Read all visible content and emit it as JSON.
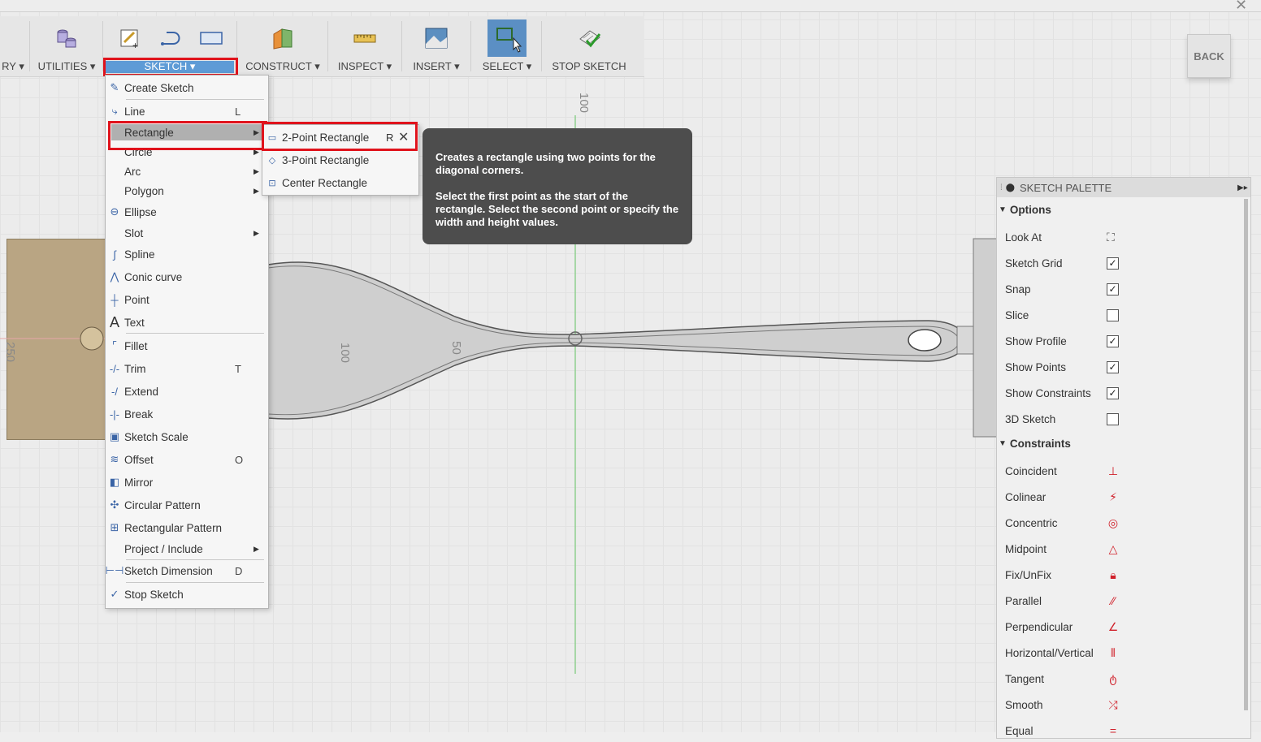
{
  "toolbar": {
    "partial_label": "RY",
    "groups": [
      {
        "label": "UTILITIES"
      },
      {
        "label": "SKETCH"
      },
      {
        "label": "CONSTRUCT"
      },
      {
        "label": "INSPECT"
      },
      {
        "label": "INSERT"
      },
      {
        "label": "SELECT"
      },
      {
        "label": "STOP SKETCH"
      }
    ],
    "dropdown_glyph": "▾"
  },
  "back_button": "BACK",
  "canvas": {
    "axis_labels": [
      "100",
      "100",
      "50",
      "250"
    ]
  },
  "sketch_menu": {
    "items": [
      {
        "label": "Create Sketch",
        "icon": "create-sketch-icon"
      },
      {
        "label": "Line",
        "shortcut": "L",
        "icon": "line-icon"
      },
      {
        "label": "Rectangle",
        "submenu": true
      },
      {
        "label": "Circle",
        "submenu": true
      },
      {
        "label": "Arc",
        "submenu": true
      },
      {
        "label": "Polygon",
        "submenu": true
      },
      {
        "label": "Ellipse",
        "icon": "ellipse-icon"
      },
      {
        "label": "Slot",
        "submenu": true
      },
      {
        "label": "Spline",
        "icon": "spline-icon"
      },
      {
        "label": "Conic curve",
        "icon": "conic-curve-icon"
      },
      {
        "label": "Point",
        "icon": "point-icon"
      },
      {
        "label": "Text",
        "icon": "text-icon"
      },
      {
        "label": "Fillet",
        "icon": "fillet-icon"
      },
      {
        "label": "Trim",
        "shortcut": "T",
        "icon": "trim-icon"
      },
      {
        "label": "Extend",
        "icon": "extend-icon"
      },
      {
        "label": "Break",
        "icon": "break-icon"
      },
      {
        "label": "Sketch Scale",
        "icon": "sketch-scale-icon"
      },
      {
        "label": "Offset",
        "shortcut": "O",
        "icon": "offset-icon"
      },
      {
        "label": "Mirror",
        "icon": "mirror-icon"
      },
      {
        "label": "Circular Pattern",
        "icon": "circular-pattern-icon"
      },
      {
        "label": "Rectangular Pattern",
        "icon": "rectangular-pattern-icon"
      },
      {
        "label": "Project / Include",
        "submenu": true
      },
      {
        "label": "Sketch Dimension",
        "shortcut": "D",
        "icon": "sketch-dimension-icon"
      },
      {
        "label": "Stop Sketch",
        "icon": "stop-sketch-icon"
      }
    ]
  },
  "rectangle_submenu": {
    "items": [
      {
        "label": "2-Point Rectangle",
        "shortcut": "R"
      },
      {
        "label": "3-Point Rectangle"
      },
      {
        "label": "Center Rectangle"
      }
    ]
  },
  "tooltip": {
    "line1": "Creates a rectangle using two points for the diagonal corners.",
    "line2": "Select the first point as the start of the rectangle. Select the second point or specify the width and height values."
  },
  "palette": {
    "title": "SKETCH PALETTE",
    "options_header": "Options",
    "options": [
      {
        "label": "Look At",
        "type": "button"
      },
      {
        "label": "Sketch Grid",
        "checked": true
      },
      {
        "label": "Snap",
        "checked": true
      },
      {
        "label": "Slice",
        "checked": false
      },
      {
        "label": "Show Profile",
        "checked": true
      },
      {
        "label": "Show Points",
        "checked": true
      },
      {
        "label": "Show Constraints",
        "checked": true
      },
      {
        "label": "3D Sketch",
        "checked": false
      }
    ],
    "constraints_header": "Constraints",
    "constraints": [
      {
        "label": "Coincident",
        "icon": "coincident-icon"
      },
      {
        "label": "Colinear",
        "icon": "colinear-icon"
      },
      {
        "label": "Concentric",
        "icon": "concentric-icon"
      },
      {
        "label": "Midpoint",
        "icon": "midpoint-icon"
      },
      {
        "label": "Fix/UnFix",
        "icon": "lock-icon"
      },
      {
        "label": "Parallel",
        "icon": "parallel-icon"
      },
      {
        "label": "Perpendicular",
        "icon": "perpendicular-icon"
      },
      {
        "label": "Horizontal/Vertical",
        "icon": "horizontal-vertical-icon"
      },
      {
        "label": "Tangent",
        "icon": "tangent-icon"
      },
      {
        "label": "Smooth",
        "icon": "smooth-icon"
      },
      {
        "label": "Equal",
        "icon": "equal-icon"
      }
    ]
  }
}
